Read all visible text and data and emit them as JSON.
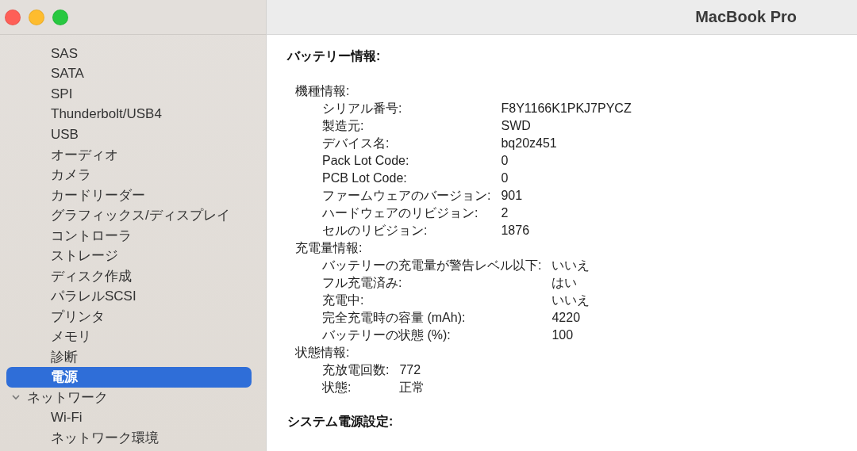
{
  "window": {
    "title": "MacBook Pro"
  },
  "sidebar": {
    "items": [
      {
        "label": "SAS",
        "selected": false
      },
      {
        "label": "SATA",
        "selected": false
      },
      {
        "label": "SPI",
        "selected": false
      },
      {
        "label": "Thunderbolt/USB4",
        "selected": false
      },
      {
        "label": "USB",
        "selected": false
      },
      {
        "label": "オーディオ",
        "selected": false
      },
      {
        "label": "カメラ",
        "selected": false
      },
      {
        "label": "カードリーダー",
        "selected": false
      },
      {
        "label": "グラフィックス/ディスプレイ",
        "selected": false
      },
      {
        "label": "コントローラ",
        "selected": false
      },
      {
        "label": "ストレージ",
        "selected": false
      },
      {
        "label": "ディスク作成",
        "selected": false
      },
      {
        "label": "パラレルSCSI",
        "selected": false
      },
      {
        "label": "プリンタ",
        "selected": false
      },
      {
        "label": "メモリ",
        "selected": false
      },
      {
        "label": "診断",
        "selected": false
      },
      {
        "label": "電源",
        "selected": true
      },
      {
        "label": "ネットワーク",
        "selected": false,
        "expanded": true,
        "children": [
          {
            "label": "Wi-Fi",
            "selected": false
          },
          {
            "label": "ネットワーク環境",
            "selected": false
          }
        ]
      }
    ]
  },
  "sections": [
    {
      "title": "バッテリー情報:",
      "groups": [
        {
          "title": "機種情報:",
          "rows": [
            {
              "label": "シリアル番号:",
              "value": "F8Y1166K1PKJ7PYCZ"
            },
            {
              "label": "製造元:",
              "value": "SWD"
            },
            {
              "label": "デバイス名:",
              "value": "bq20z451"
            },
            {
              "label": "Pack Lot Code:",
              "value": "0"
            },
            {
              "label": "PCB Lot Code:",
              "value": "0"
            },
            {
              "label": "ファームウェアのバージョン:",
              "value": "901"
            },
            {
              "label": "ハードウェアのリビジョン:",
              "value": "2"
            },
            {
              "label": "セルのリビジョン:",
              "value": "1876"
            }
          ]
        },
        {
          "title": "充電量情報:",
          "rows": [
            {
              "label": "バッテリーの充電量が警告レベル以下:",
              "value": "いいえ"
            },
            {
              "label": "フル充電済み:",
              "value": "はい"
            },
            {
              "label": "充電中:",
              "value": "いいえ"
            },
            {
              "label": "完全充電時の容量 (mAh):",
              "value": "4220"
            },
            {
              "label": "バッテリーの状態 (%):",
              "value": "100"
            }
          ]
        },
        {
          "title": "状態情報:",
          "rows": [
            {
              "label": "充放電回数:",
              "value": "772"
            },
            {
              "label": "状態:",
              "value": "正常"
            }
          ]
        }
      ]
    },
    {
      "title": "システム電源設定:"
    }
  ]
}
